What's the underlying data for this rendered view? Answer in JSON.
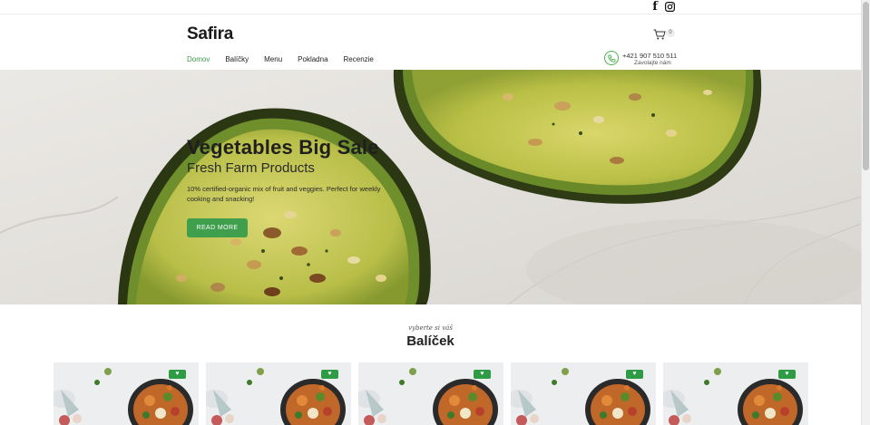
{
  "topbar": {
    "facebook_icon": "facebook-icon",
    "instagram_icon": "instagram-icon"
  },
  "header": {
    "logo": "Safira",
    "cart_count": "0",
    "nav": [
      {
        "label": "Domov",
        "active": true
      },
      {
        "label": "Balíčky",
        "active": false
      },
      {
        "label": "Menu",
        "active": false
      },
      {
        "label": "Pokladna",
        "active": false
      },
      {
        "label": "Recenzie",
        "active": false
      }
    ],
    "phone": {
      "number": "+421 907 510 511",
      "label": "Zavolajte nám"
    }
  },
  "hero": {
    "title": "Vegetables Big Sale",
    "subtitle": "Fresh Farm Products",
    "description": "10% certified-organic mix of fruit and veggies. Perfect for weekly cooking and snacking!",
    "button": "READ MORE"
  },
  "section": {
    "eyebrow": "vyberte si váš",
    "title": "Balíček"
  },
  "colors": {
    "accent": "#3f9f4c",
    "badge": "#2e9c45"
  }
}
